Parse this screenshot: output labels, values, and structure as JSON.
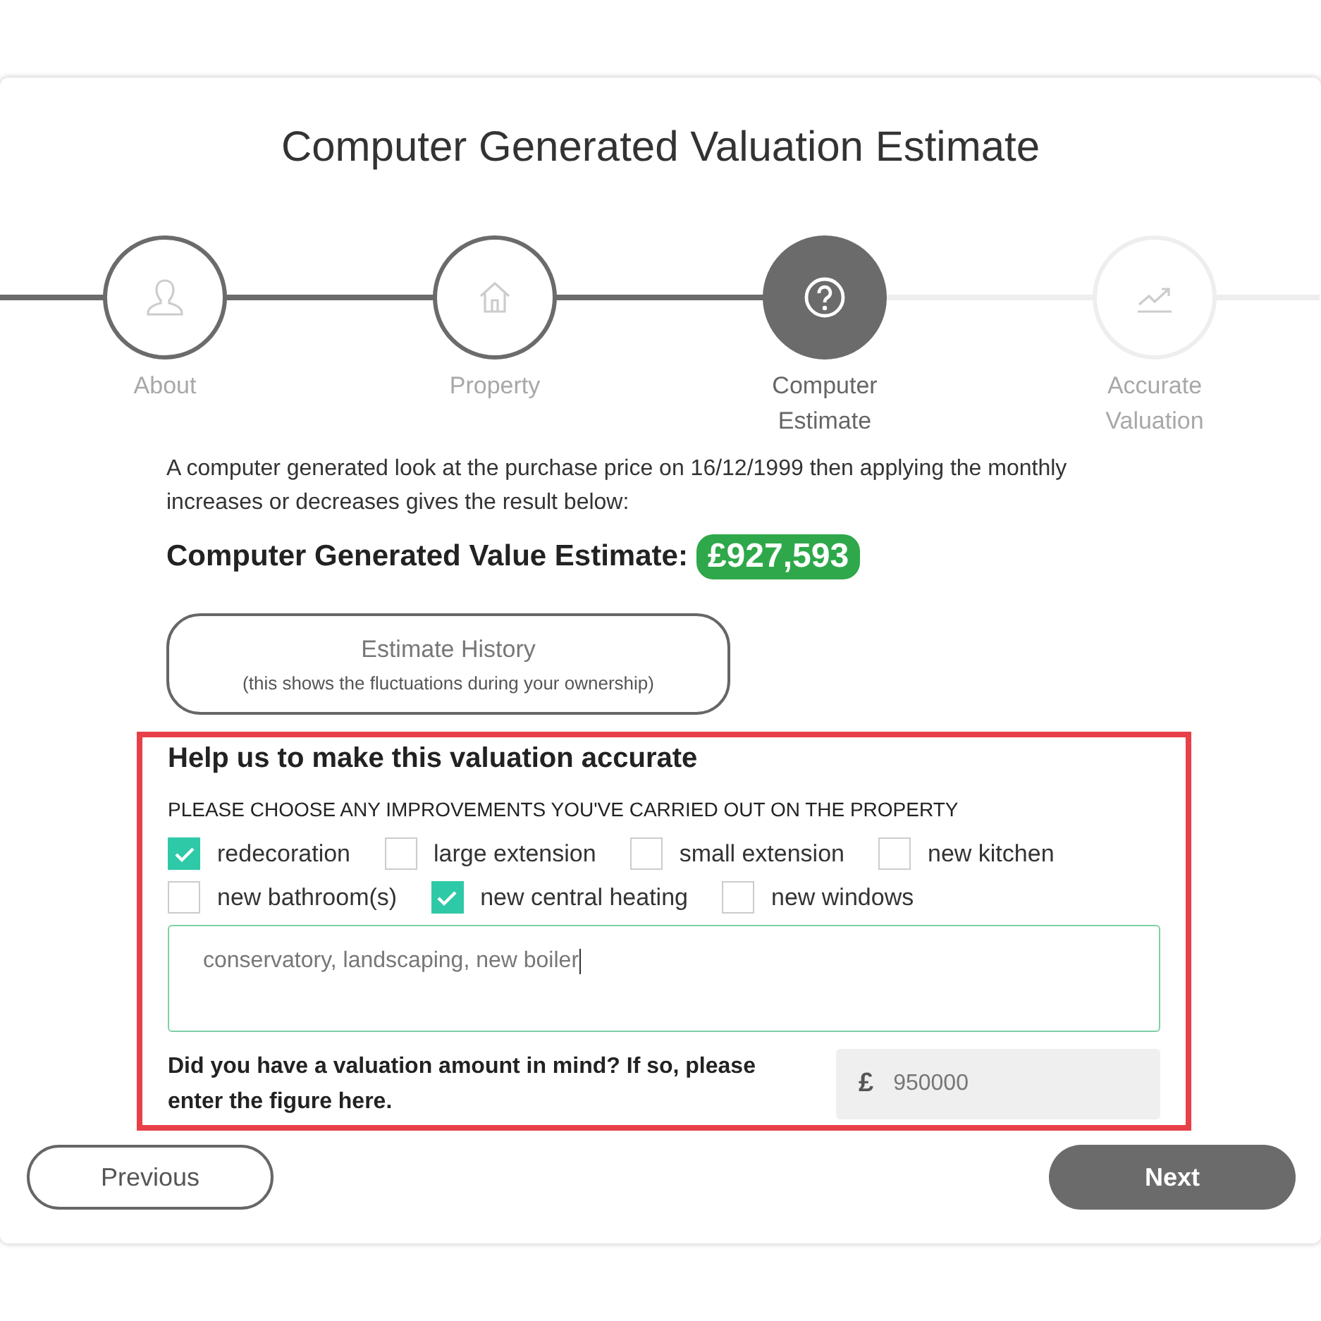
{
  "title": "Computer Generated Valuation Estimate",
  "steps": [
    {
      "label": "About",
      "kind": "done"
    },
    {
      "label": "Property",
      "kind": "done"
    },
    {
      "label": "Computer Estimate",
      "kind": "current"
    },
    {
      "label": "Accurate Valuation",
      "kind": "upcoming"
    }
  ],
  "intro": "A computer generated look at the purchase price on 16/12/1999 then applying the monthly increases or decreases gives the result below:",
  "estimate": {
    "label": "Computer Generated Value Estimate:",
    "value": "£927,593"
  },
  "history_button": {
    "label": "Estimate History",
    "sublabel": "(this shows the fluctuations during your ownership)"
  },
  "improvements": {
    "highlighted": true,
    "heading": "Help us to make this valuation accurate",
    "prompt": "PLEASE CHOOSE ANY IMPROVEMENTS YOU'VE CARRIED OUT ON THE PROPERTY",
    "options": [
      {
        "label": "redecoration",
        "checked": true
      },
      {
        "label": "large extension",
        "checked": false
      },
      {
        "label": "small extension",
        "checked": false
      },
      {
        "label": "new kitchen",
        "checked": false
      },
      {
        "label": "new bathroom(s)",
        "checked": false
      },
      {
        "label": "new central heating",
        "checked": true
      },
      {
        "label": "new windows",
        "checked": false
      }
    ],
    "other": {
      "value": "conservatory, landscaping, new boiler"
    },
    "amount_question": "Did you have a valuation amount in mind? If so, please enter the figure here.",
    "currency": "£",
    "amount": {
      "value": "950000"
    }
  },
  "buttons": [
    {
      "label": "Previous",
      "kind": "secondary"
    },
    {
      "label": "Next",
      "kind": "primary"
    }
  ]
}
